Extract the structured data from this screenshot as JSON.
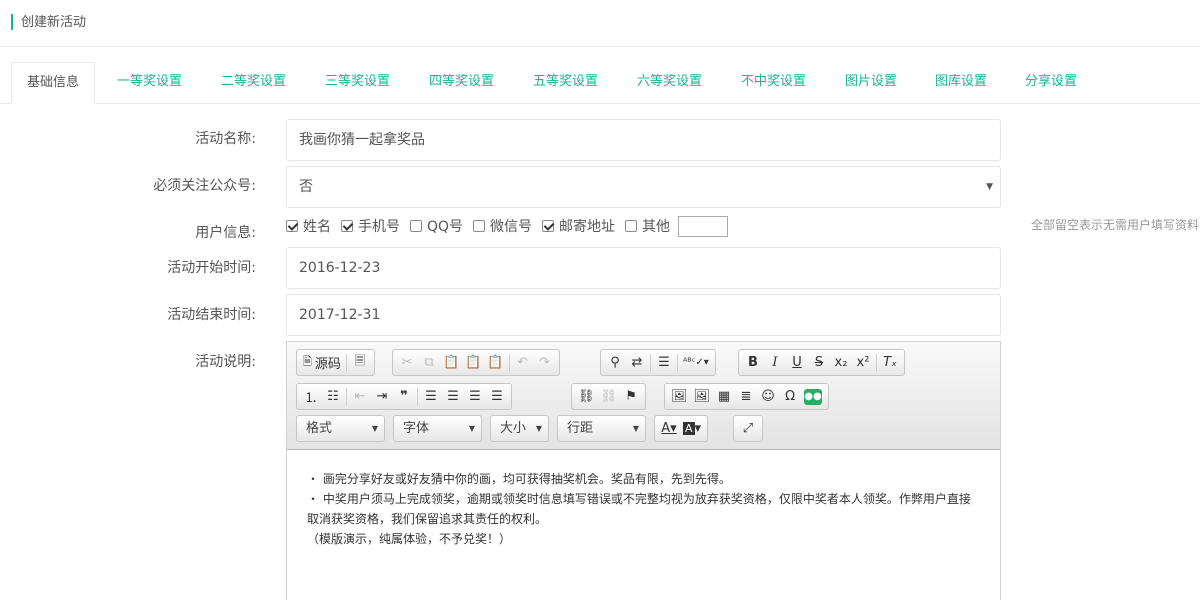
{
  "header": {
    "title": "创建新活动"
  },
  "tabs": [
    "基础信息",
    "一等奖设置",
    "二等奖设置",
    "三等奖设置",
    "四等奖设置",
    "五等奖设置",
    "六等奖设置",
    "不中奖设置",
    "图片设置",
    "图库设置",
    "分享设置"
  ],
  "form": {
    "name_label": "活动名称:",
    "name_value": "我画你猜一起拿奖品",
    "follow_label": "必须关注公众号:",
    "follow_value": "否",
    "userinfo_label": "用户信息:",
    "userinfo_options": [
      {
        "label": "姓名",
        "checked": true
      },
      {
        "label": "手机号",
        "checked": true
      },
      {
        "label": "QQ号",
        "checked": false
      },
      {
        "label": "微信号",
        "checked": false
      },
      {
        "label": "邮寄地址",
        "checked": true
      },
      {
        "label": "其他",
        "checked": false
      }
    ],
    "userinfo_hint": "全部留空表示无需用户填写资料",
    "start_label": "活动开始时间:",
    "start_value": "2016-12-23",
    "end_label": "活动结束时间:",
    "end_value": "2017-12-31",
    "desc_label": "活动说明:"
  },
  "editor": {
    "source_label": "源码",
    "format_label": "格式",
    "font_label": "字体",
    "size_label": "大小",
    "lineheight_label": "行距",
    "content": [
      "・ 画完分享好友或好友猜中你的画，均可获得抽奖机会。奖品有限，先到先得。",
      "・ 中奖用户须马上完成领奖，逾期或领奖时信息填写错误或不完整均视为放弃获奖资格，仅限中奖者本人领奖。作弊用户直接取消获奖资格，我们保留追求其责任的权利。",
      "（模版演示，纯属体验，不予兑奖！）"
    ]
  },
  "colors": {
    "accent": "#1ab394",
    "wechat": "#27ae60"
  }
}
